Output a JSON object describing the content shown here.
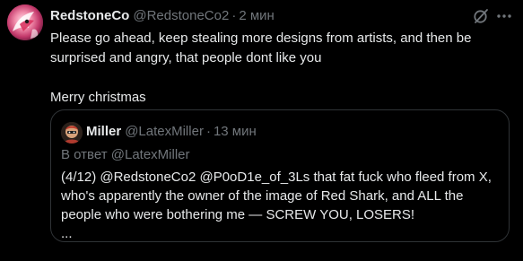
{
  "tweet": {
    "author": {
      "name": "RedstoneCo",
      "handle": "@RedstoneCo2",
      "separator": "·",
      "time": "2 мин"
    },
    "body": {
      "line1": "Please go ahead, keep stealing more designs from artists, and then be surprised and angry, that people dont like you",
      "line2": "Merry christmas"
    },
    "icons": {
      "grok": "grok-icon",
      "more": "more-icon"
    }
  },
  "quote": {
    "author": {
      "name": "Miller",
      "handle": "@LatexMiller",
      "separator": "·",
      "time": "13 мин"
    },
    "reply_prefix": "В ответ",
    "reply_handle": "@LatexMiller",
    "text": "(4/12) @RedstoneCo2 @P0oD1e_of_3Ls that fat fuck who fleed from X, who's apparently the owner of the image of Red Shark, and ALL the people who were bothering me — SCREW YOU, LOSERS!",
    "ellipsis": "..."
  },
  "colors": {
    "background": "#000000",
    "primary_text": "#e7e9ea",
    "secondary_text": "#71767b",
    "border": "#2f3336"
  }
}
